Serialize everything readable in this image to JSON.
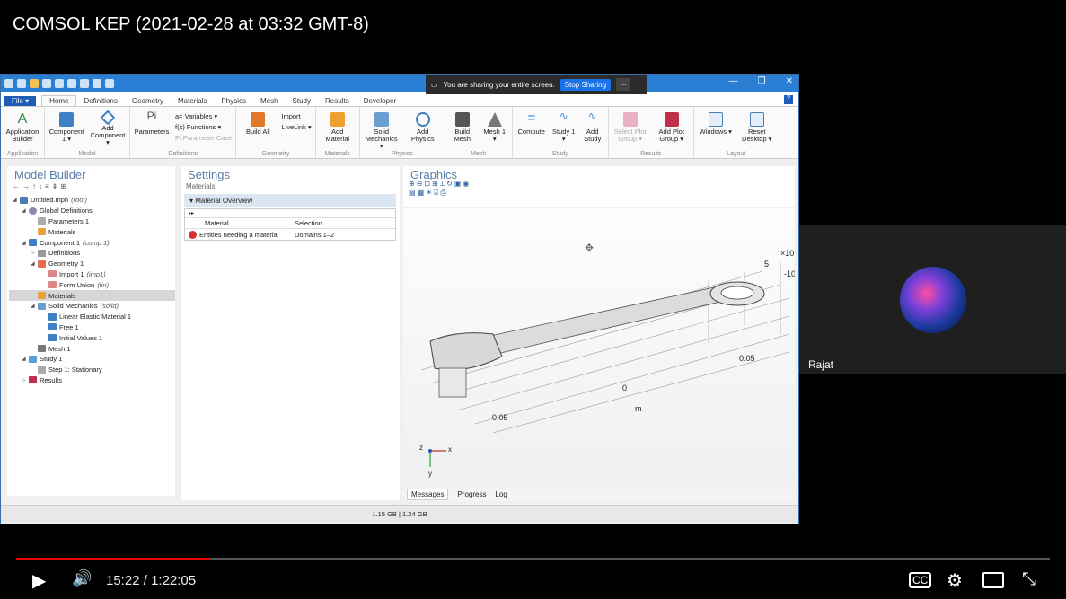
{
  "video": {
    "title": "COMSOL KEP (2021-02-28 at 03:32 GMT-8)",
    "current_time": "15:22",
    "separator": "/",
    "duration": "1:22:05",
    "progress": 0.1874,
    "participant": "Rajat"
  },
  "share_bar": {
    "message": "You are sharing your entire screen.",
    "stop_label": "Stop Sharing",
    "more_label": "..."
  },
  "app": {
    "tabs": [
      "File ▾",
      "Home",
      "Definitions",
      "Geometry",
      "Materials",
      "Physics",
      "Mesh",
      "Study",
      "Results",
      "Developer"
    ],
    "help": "?",
    "ribbon": {
      "application": {
        "label": "Application",
        "item": "Application Builder"
      },
      "model": {
        "label": "Model",
        "items": [
          "Component 1 ▾",
          "Add Component ▾"
        ]
      },
      "definitions": {
        "label": "Definitions",
        "param": "Parameters",
        "small": [
          "a= Variables ▾",
          "f(x) Functions ▾",
          "Pi Parameter Case"
        ]
      },
      "geometry": {
        "label": "Geometry",
        "build": "Build All",
        "small": [
          "Import",
          "LiveLink ▾"
        ]
      },
      "materials": {
        "label": "Materials",
        "item": "Add Material"
      },
      "physics": {
        "label": "Physics",
        "items": [
          "Solid Mechanics ▾",
          "Add Physics"
        ]
      },
      "mesh": {
        "label": "Mesh",
        "items": [
          "Build Mesh",
          "Mesh 1 ▾"
        ]
      },
      "study": {
        "label": "Study",
        "items": [
          "Compute",
          "Study 1 ▾",
          "Add Study"
        ]
      },
      "results": {
        "label": "Results",
        "items": [
          "Select Plot Group ▾",
          "Add Plot Group ▾"
        ]
      },
      "layout": {
        "label": "Layout",
        "items": [
          "Windows ▾",
          "Reset Desktop ▾"
        ]
      }
    },
    "model_builder": {
      "title": "Model Builder",
      "tree": [
        {
          "label": "Untitled.mph",
          "note": "(root)",
          "level": 0
        },
        {
          "label": "Global Definitions",
          "note": "",
          "level": 1
        },
        {
          "label": "Parameters 1",
          "note": "",
          "level": 2
        },
        {
          "label": "Materials",
          "note": "",
          "level": 2
        },
        {
          "label": "Component 1",
          "note": "(comp 1)",
          "level": 1
        },
        {
          "label": "Definitions",
          "note": "",
          "level": 2
        },
        {
          "label": "Geometry 1",
          "note": "",
          "level": 2
        },
        {
          "label": "Import 1",
          "note": "(imp1)",
          "level": 3
        },
        {
          "label": "Form Union",
          "note": "(fin)",
          "level": 3
        },
        {
          "label": "Materials",
          "note": "",
          "level": 2
        },
        {
          "label": "Solid Mechanics",
          "note": "(solid)",
          "level": 2
        },
        {
          "label": "Linear Elastic Material 1",
          "note": "",
          "level": 3
        },
        {
          "label": "Free 1",
          "note": "",
          "level": 3
        },
        {
          "label": "Initial Values 1",
          "note": "",
          "level": 3
        },
        {
          "label": "Mesh 1",
          "note": "",
          "level": 2
        },
        {
          "label": "Study 1",
          "note": "",
          "level": 1
        },
        {
          "label": "Step 1: Stationary",
          "note": "",
          "level": 2
        },
        {
          "label": "Results",
          "note": "",
          "level": 1
        }
      ]
    },
    "settings": {
      "title": "Settings",
      "subtitle": "Materials",
      "section": "Material Overview",
      "col_material": "Material",
      "col_selection": "Selection",
      "row_material": "Entities needing a material",
      "row_selection": "Domains 1–2"
    },
    "graphics": {
      "title": "Graphics",
      "labels": {
        "x10": "×10",
        "five": "5",
        "neg10": "-10",
        "p005": "0.05",
        "zero": "0",
        "n005": "-0.05",
        "m": "m",
        "ax_z": "z",
        "ax_x": "x",
        "ax_y": "y"
      }
    },
    "bottom_tabs": [
      "Messages",
      "Progress",
      "Log"
    ],
    "status": "1.15 GB | 1.24 GB"
  }
}
